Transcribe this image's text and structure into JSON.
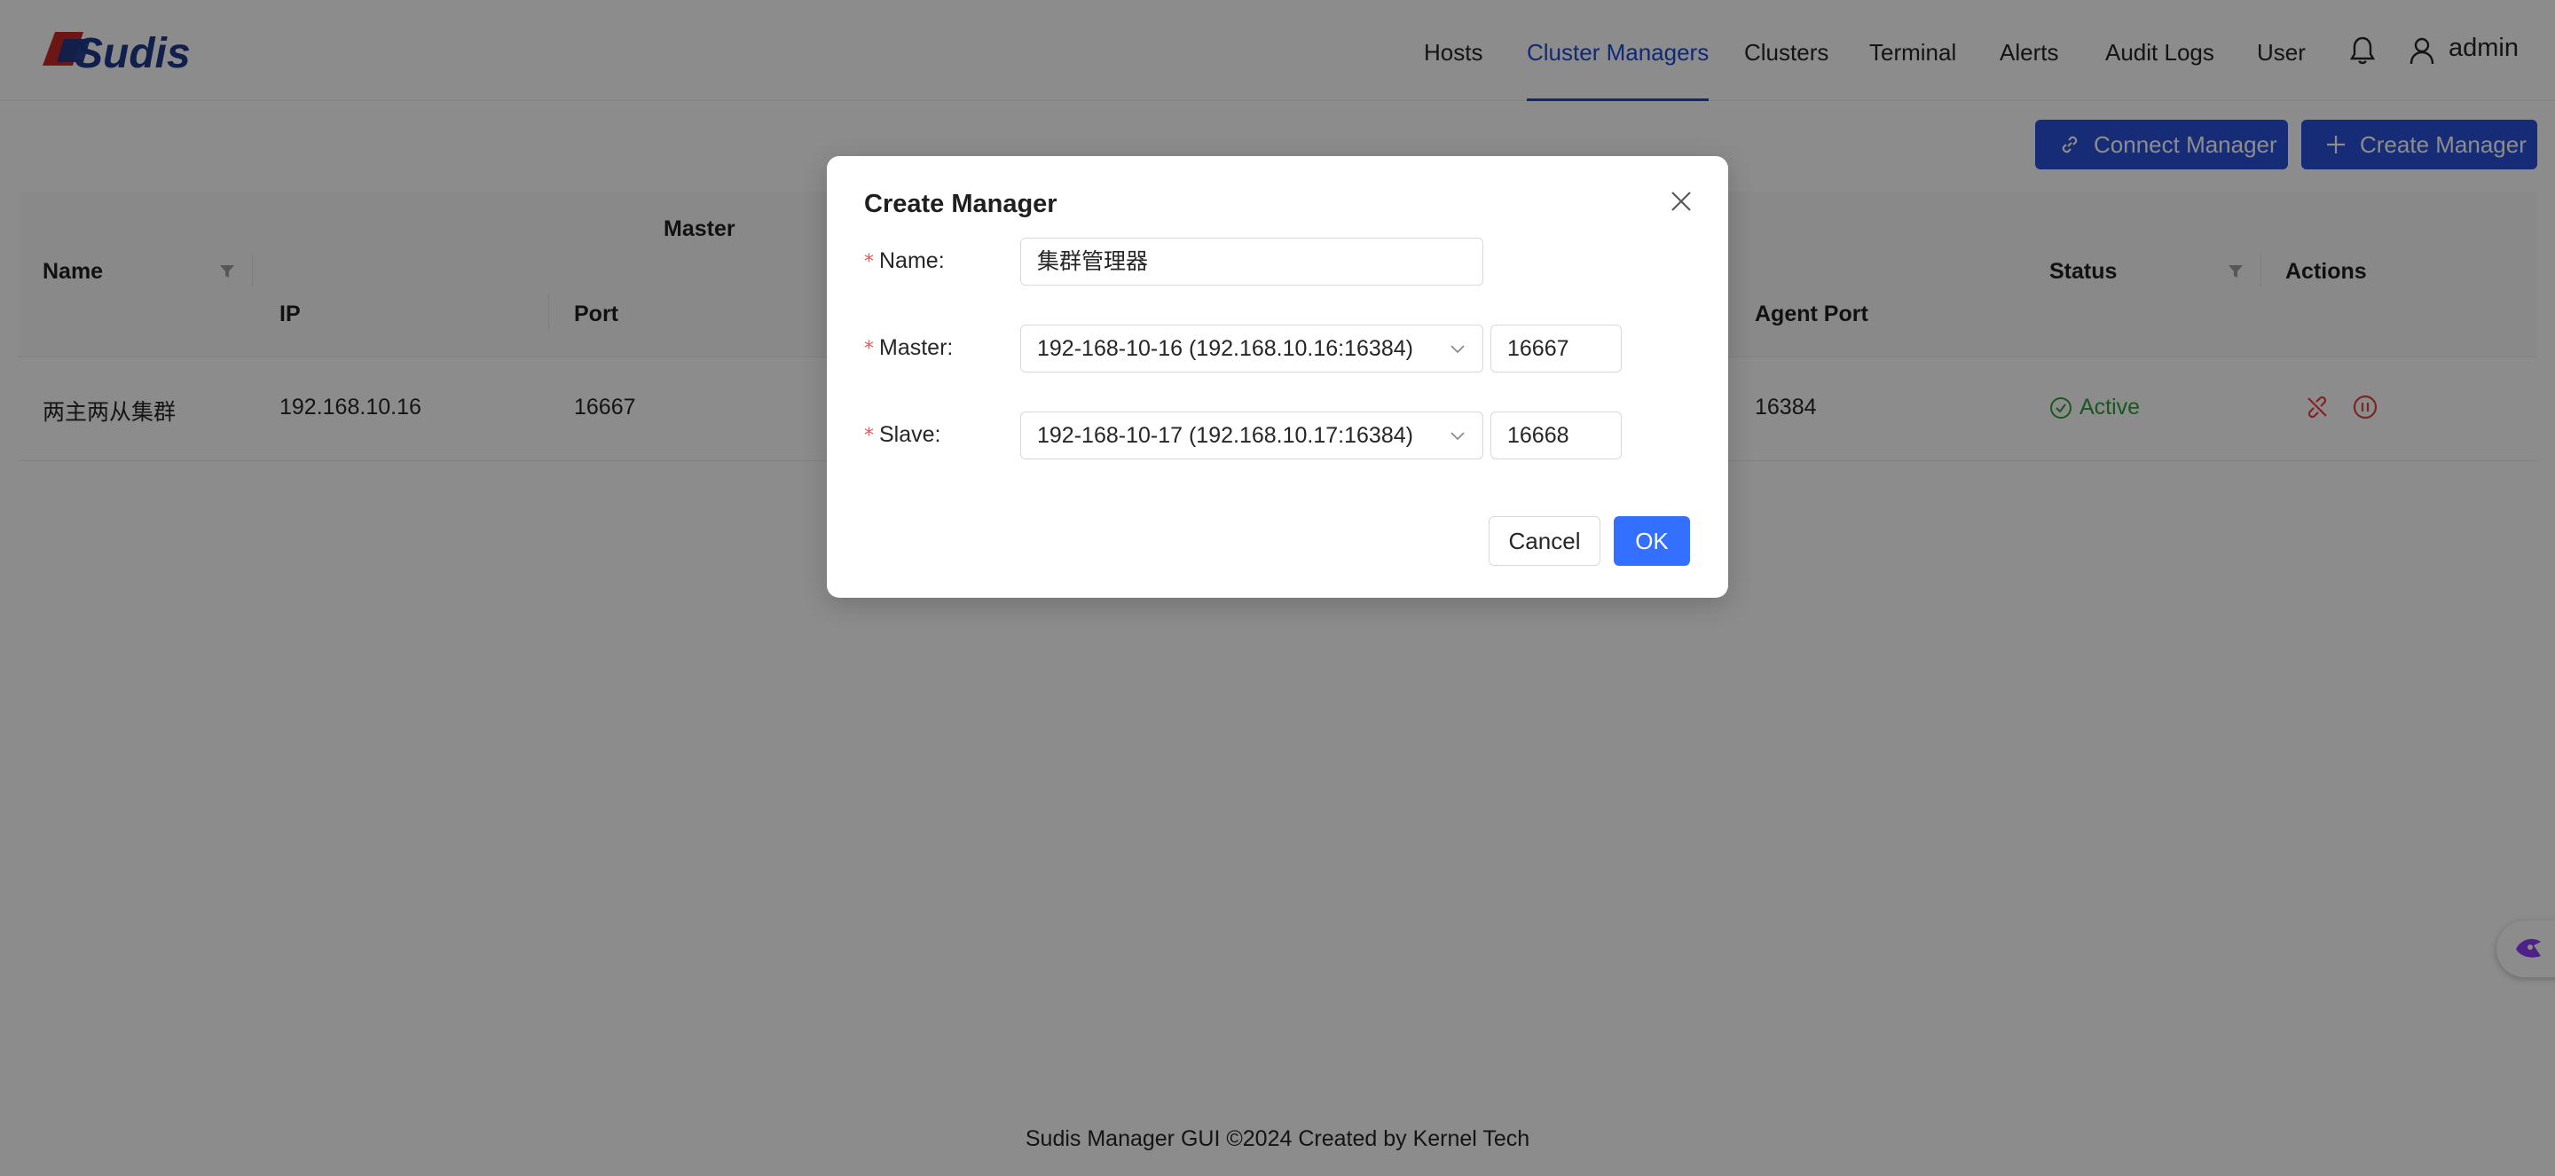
{
  "app": {
    "logo_text": "Sudis",
    "logo_colors": [
      "#1e3a8a",
      "#c62828"
    ]
  },
  "nav": {
    "items": [
      {
        "label": "Hosts"
      },
      {
        "label": "Cluster Managers",
        "active": true
      },
      {
        "label": "Clusters"
      },
      {
        "label": "Terminal"
      },
      {
        "label": "Alerts"
      },
      {
        "label": "Audit Logs"
      },
      {
        "label": "User"
      }
    ],
    "user_name": "admin"
  },
  "toolbar": {
    "connect_label": "Connect Manager",
    "create_label": "Create Manager"
  },
  "table": {
    "group_master": "Master",
    "columns": {
      "name": "Name",
      "ip": "IP",
      "port": "Port",
      "agent_port": "Agent Port",
      "status": "Status",
      "actions": "Actions"
    },
    "rows": [
      {
        "name": "两主两从集群",
        "ip": "192.168.10.16",
        "port": "16667",
        "agent_port": "16384",
        "status": "Active"
      }
    ]
  },
  "modal": {
    "title": "Create Manager",
    "name_label": "Name",
    "name_value": "集群管理器",
    "master_label": "Master",
    "master_value": "192-168-10-16 (192.168.10.16:16384)",
    "master_port": "16667",
    "slave_label": "Slave",
    "slave_value": "192-168-10-17 (192.168.10.17:16384)",
    "slave_port": "16668",
    "cancel_label": "Cancel",
    "ok_label": "OK"
  },
  "footer": {
    "text": "Sudis Manager GUI ©2024 Created by Kernel Tech"
  },
  "colors": {
    "primary": "#2b50d9",
    "ok_button": "#3370ff",
    "active_status": "#2e9e3b",
    "danger_icon": "#e0443e",
    "float_icon": "#8b3cf7"
  }
}
